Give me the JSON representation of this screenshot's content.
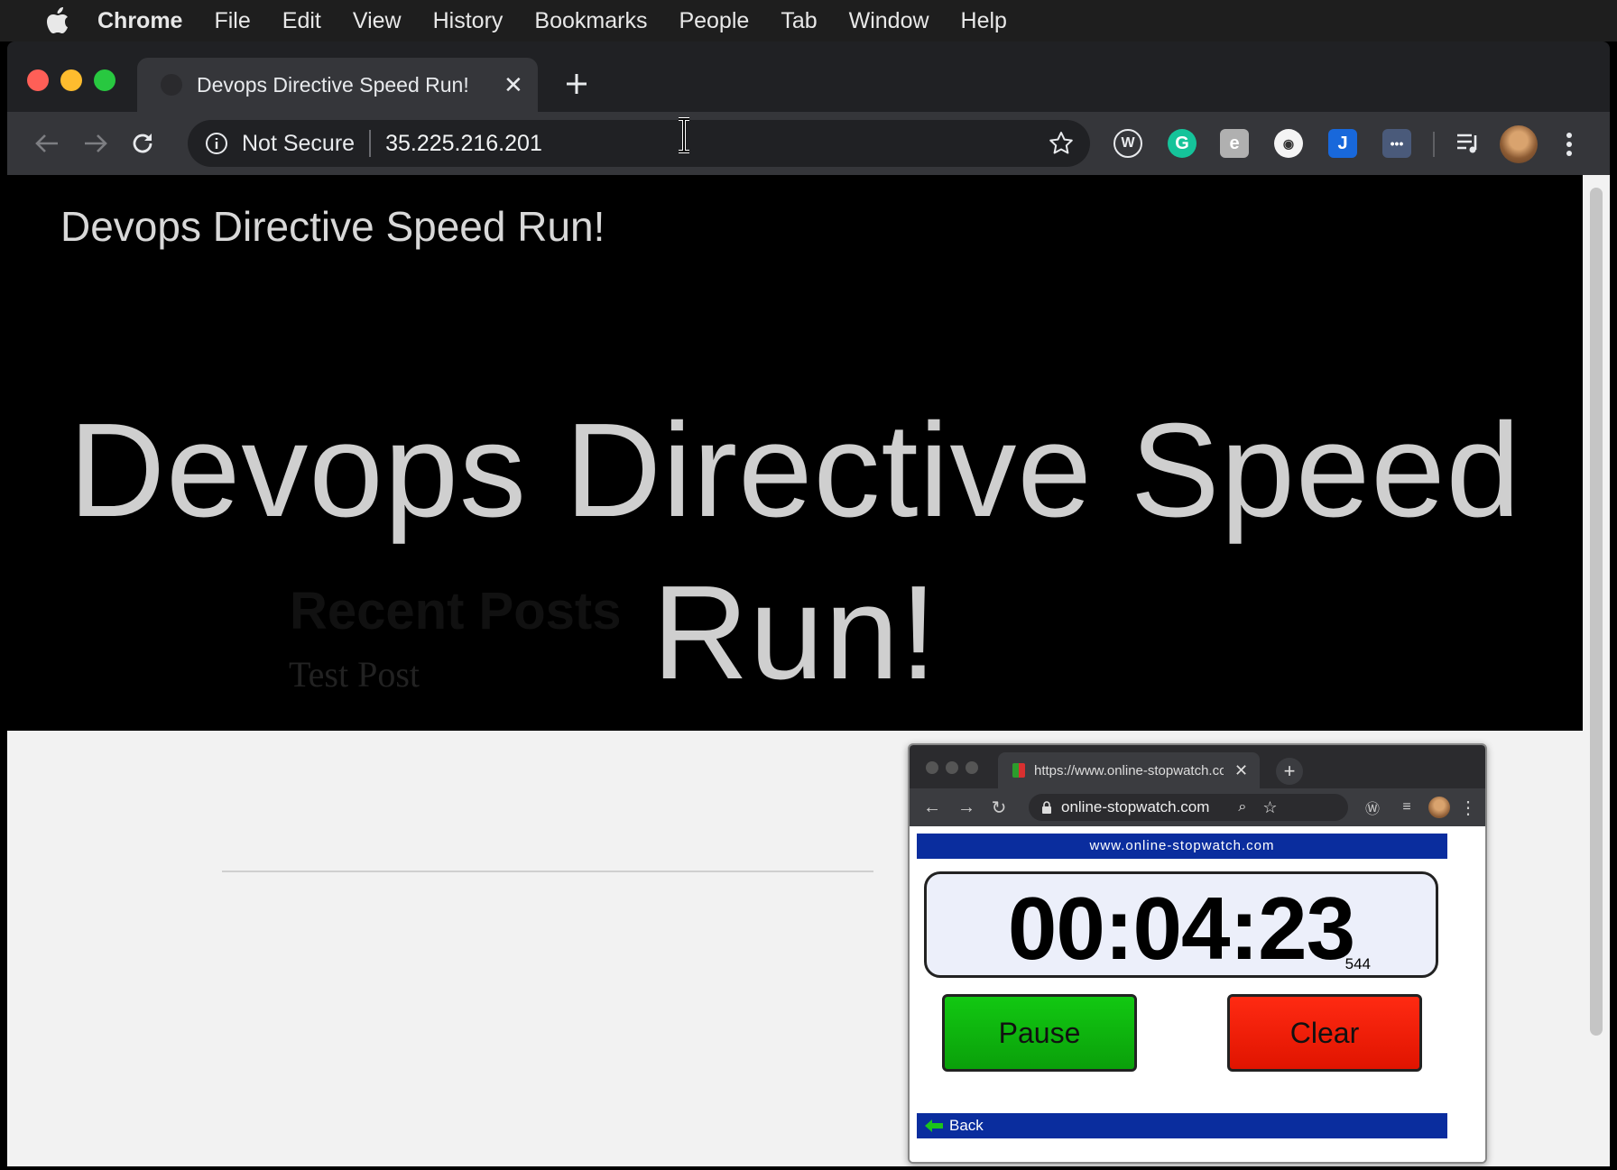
{
  "menubar": {
    "app": "Chrome",
    "items": [
      "File",
      "Edit",
      "View",
      "History",
      "Bookmarks",
      "People",
      "Tab",
      "Window",
      "Help"
    ]
  },
  "browser": {
    "tab_title": "Devops Directive Speed Run!",
    "security_label": "Not Secure",
    "url": "35.225.216.201",
    "extensions": [
      "wordpress-icon",
      "grammarly-icon",
      "evernote-icon",
      "eye-extension-icon",
      "jira-icon",
      "more-extensions-icon",
      "media-control-icon"
    ]
  },
  "page": {
    "site_title": "Devops Directive Speed Run!",
    "hero_line1": "Devops Directive Speed",
    "hero_line2": "Run!",
    "recent_posts_heading": "Recent Posts",
    "posts": [
      "Test Post"
    ]
  },
  "stopwatch": {
    "tab_title": "https://www.online-stopwatch.com",
    "url": "online-stopwatch.com",
    "banner": "www.online-stopwatch.com",
    "time": "00:04:23",
    "milliseconds": "544",
    "pause_label": "Pause",
    "clear_label": "Clear",
    "back_label": "Back"
  },
  "colors": {
    "pause_button": "#10c010",
    "clear_button": "#ff1e08",
    "banner": "#0a2d9e",
    "chrome_dark": "#35363a"
  }
}
